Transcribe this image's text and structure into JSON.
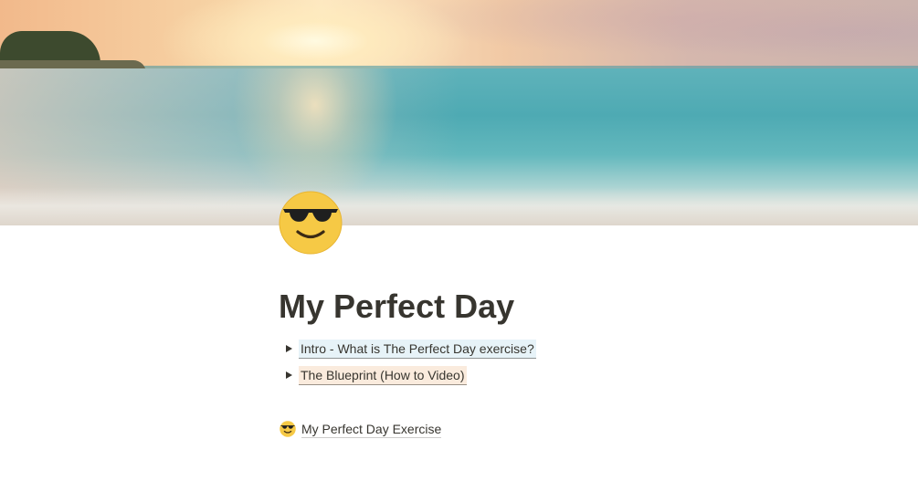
{
  "page": {
    "title": "My Perfect Day",
    "icon": "smiling-face-with-sunglasses-icon",
    "cover": "sunset-beach-cover"
  },
  "toggles": [
    {
      "label": "Intro - What is The Perfect Day exercise?",
      "highlight": "#e7f3f8"
    },
    {
      "label": "The Blueprint (How to Video)",
      "highlight": "#faebdd"
    }
  ],
  "page_link": {
    "icon": "smiling-face-with-sunglasses-icon",
    "label": "My Perfect Day Exercise"
  },
  "colors": {
    "text": "#37352f",
    "emoji_face": "#f6c945"
  }
}
